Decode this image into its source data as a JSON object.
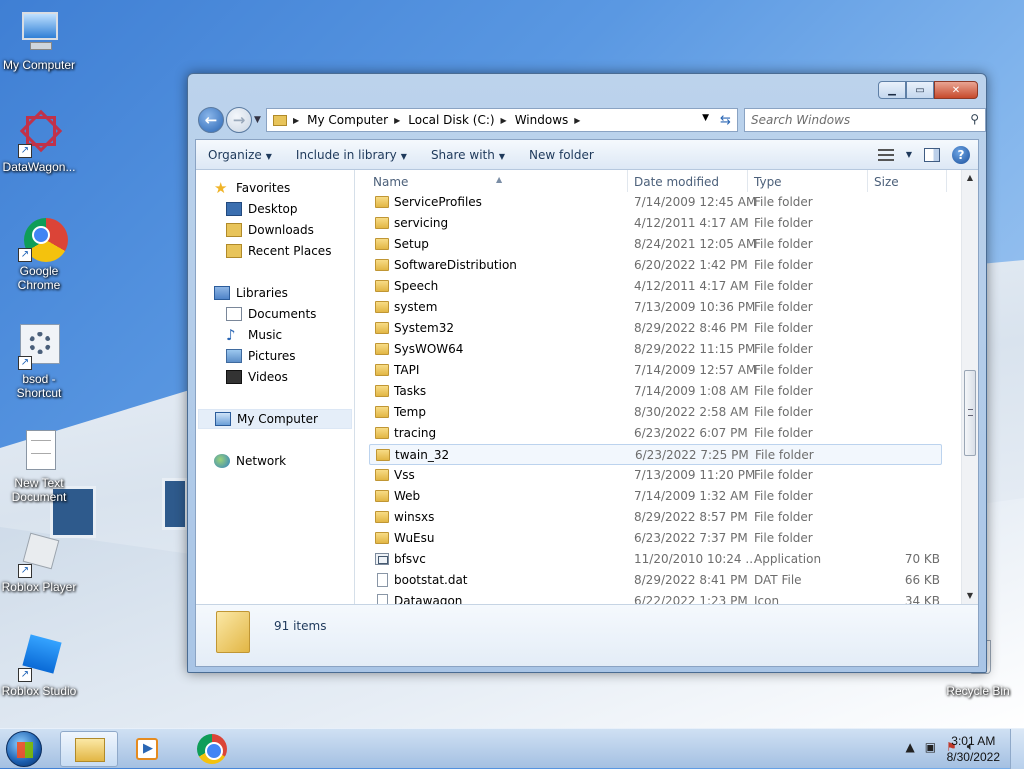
{
  "desktop": {
    "icons": [
      {
        "label": "My Computer"
      },
      {
        "label": "DataWagon..."
      },
      {
        "label": "Google Chrome"
      },
      {
        "label": "bsod - Shortcut"
      },
      {
        "label": "New Text Document"
      },
      {
        "label": "Roblox Player"
      },
      {
        "label": "Roblox Studio"
      },
      {
        "label": "Recycle Bin"
      }
    ]
  },
  "window": {
    "breadcrumb": [
      "My Computer",
      "Local Disk (C:)",
      "Windows"
    ],
    "search_placeholder": "Search Windows",
    "toolbar": {
      "organize": "Organize",
      "include": "Include in library",
      "share": "Share with",
      "new_folder": "New folder"
    },
    "nav": {
      "favorites": "Favorites",
      "desktop": "Desktop",
      "downloads": "Downloads",
      "recent": "Recent Places",
      "libraries": "Libraries",
      "documents": "Documents",
      "music": "Music",
      "pictures": "Pictures",
      "videos": "Videos",
      "my_computer": "My Computer",
      "network": "Network"
    },
    "columns": {
      "name": "Name",
      "date": "Date modified",
      "type": "Type",
      "size": "Size"
    },
    "files": [
      {
        "name": "ServiceProfiles",
        "date": "7/14/2009 12:45 AM",
        "type": "File folder",
        "size": "",
        "icon": "folder"
      },
      {
        "name": "servicing",
        "date": "4/12/2011 4:17 AM",
        "type": "File folder",
        "size": "",
        "icon": "folder"
      },
      {
        "name": "Setup",
        "date": "8/24/2021 12:05 AM",
        "type": "File folder",
        "size": "",
        "icon": "folder"
      },
      {
        "name": "SoftwareDistribution",
        "date": "6/20/2022 1:42 PM",
        "type": "File folder",
        "size": "",
        "icon": "folder"
      },
      {
        "name": "Speech",
        "date": "4/12/2011 4:17 AM",
        "type": "File folder",
        "size": "",
        "icon": "folder"
      },
      {
        "name": "system",
        "date": "7/13/2009 10:36 PM",
        "type": "File folder",
        "size": "",
        "icon": "folder"
      },
      {
        "name": "System32",
        "date": "8/29/2022 8:46 PM",
        "type": "File folder",
        "size": "",
        "icon": "folder"
      },
      {
        "name": "SysWOW64",
        "date": "8/29/2022 11:15 PM",
        "type": "File folder",
        "size": "",
        "icon": "folder"
      },
      {
        "name": "TAPI",
        "date": "7/14/2009 12:57 AM",
        "type": "File folder",
        "size": "",
        "icon": "folder"
      },
      {
        "name": "Tasks",
        "date": "7/14/2009 1:08 AM",
        "type": "File folder",
        "size": "",
        "icon": "folder"
      },
      {
        "name": "Temp",
        "date": "8/30/2022 2:58 AM",
        "type": "File folder",
        "size": "",
        "icon": "folder"
      },
      {
        "name": "tracing",
        "date": "6/23/2022 6:07 PM",
        "type": "File folder",
        "size": "",
        "icon": "folder"
      },
      {
        "name": "twain_32",
        "date": "6/23/2022 7:25 PM",
        "type": "File folder",
        "size": "",
        "icon": "folder",
        "hover": true
      },
      {
        "name": "Vss",
        "date": "7/13/2009 11:20 PM",
        "type": "File folder",
        "size": "",
        "icon": "folder"
      },
      {
        "name": "Web",
        "date": "7/14/2009 1:32 AM",
        "type": "File folder",
        "size": "",
        "icon": "folder"
      },
      {
        "name": "winsxs",
        "date": "8/29/2022 8:57 PM",
        "type": "File folder",
        "size": "",
        "icon": "folder"
      },
      {
        "name": "WuEsu",
        "date": "6/23/2022 7:37 PM",
        "type": "File folder",
        "size": "",
        "icon": "folder"
      },
      {
        "name": "bfsvc",
        "date": "11/20/2010 10:24 ...",
        "type": "Application",
        "size": "70 KB",
        "icon": "app"
      },
      {
        "name": "bootstat.dat",
        "date": "8/29/2022 8:41 PM",
        "type": "DAT File",
        "size": "66 KB",
        "icon": "doc"
      },
      {
        "name": "Datawagon",
        "date": "6/22/2022 1:23 PM",
        "type": "Icon",
        "size": "34 KB",
        "icon": "doc"
      }
    ],
    "item_count": "91 items"
  },
  "taskbar": {
    "time": "3:01 AM",
    "date": "8/30/2022"
  }
}
